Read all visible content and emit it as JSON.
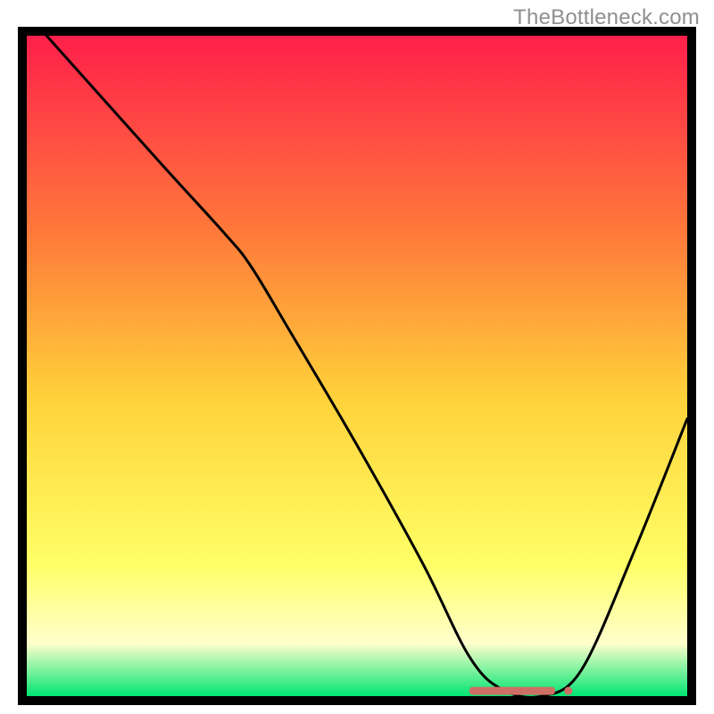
{
  "watermark": "TheBottleneck.com",
  "colors": {
    "gradient_top": "#ff1f4b",
    "gradient_mid_upper": "#ff7a3a",
    "gradient_mid": "#ffd23a",
    "gradient_lower": "#ffff66",
    "gradient_pale": "#ffffcc",
    "gradient_green": "#00e572",
    "frame": "#000000",
    "curve": "#000000",
    "marker": "#cd6f64"
  },
  "chart_data": {
    "type": "line",
    "title": "",
    "xlabel": "",
    "ylabel": "",
    "xlim": [
      0,
      100
    ],
    "ylim": [
      0,
      100
    ],
    "series": [
      {
        "name": "bottleneck-curve",
        "x": [
          3,
          20,
          30,
          34,
          40,
          50,
          60,
          67,
          72,
          78,
          84,
          92,
          100
        ],
        "values": [
          100,
          81,
          70,
          65,
          55,
          38,
          20,
          6,
          1,
          0,
          4,
          22,
          42
        ]
      }
    ],
    "annotations": [
      {
        "name": "optimal-marker",
        "shape": "rounded-bar",
        "x_start": 67,
        "x_end": 80,
        "y": 0.8,
        "dot_x": 82,
        "dot_y": 0.8
      }
    ]
  }
}
